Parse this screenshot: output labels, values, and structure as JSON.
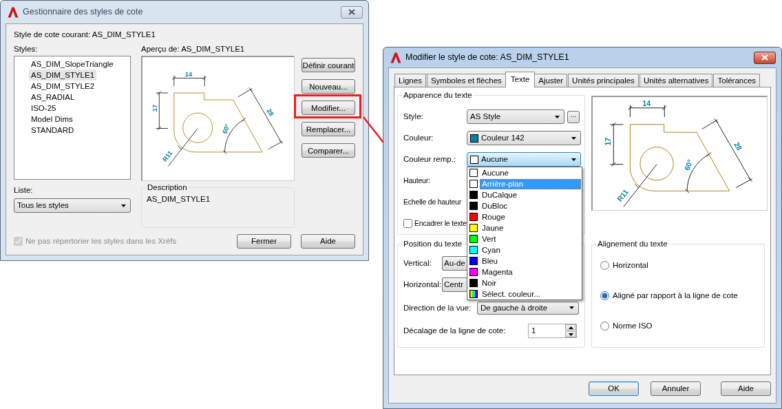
{
  "style_manager": {
    "title": "Gestionnaire des styles de cote",
    "active": false,
    "current_style": "Style de cote courant: AS_DIM_STYLE1",
    "styles_label": "Styles:",
    "styles": [
      {
        "label": "AS_DIM_SlopeTriangle",
        "selected": false
      },
      {
        "label": "AS_DIM_STYLE1",
        "selected": true
      },
      {
        "label": "AS_DIM_STYLE2",
        "selected": false
      },
      {
        "label": "AS_RADIAL",
        "selected": false
      },
      {
        "label": "ISO-25",
        "selected": false
      },
      {
        "label": "Model Dims",
        "selected": false
      },
      {
        "label": "STANDARD",
        "selected": false
      }
    ],
    "list_label": "Liste:",
    "list_filter": "Tous les styles",
    "preview_label": "Aperçu de: AS_DIM_STYLE1",
    "preview_dimensions": [
      "14",
      "17",
      "28",
      "60°",
      "R11"
    ],
    "description_label": "Description",
    "description": "AS_DIM_STYLE1",
    "buttons": [
      {
        "label": "Définir courant",
        "highlighted": false
      },
      {
        "label": "Nouveau...",
        "highlighted": false
      },
      {
        "label": "Modifier...",
        "highlighted": true
      },
      {
        "label": "Remplacer...",
        "highlighted": false
      },
      {
        "label": "Comparer...",
        "highlighted": false
      }
    ],
    "xref_option": {
      "label": "Ne pas répertorier les styles dans les Xréfs",
      "checked": true,
      "disabled": true
    },
    "footer_buttons": [
      {
        "label": "Fermer",
        "default": false
      },
      {
        "label": "Aide",
        "default": false
      }
    ]
  },
  "modify_dialog": {
    "title": "Modifier le style de cote: AS_DIM_STYLE1",
    "active": true,
    "tabs": [
      {
        "label": "Lignes",
        "selected": false
      },
      {
        "label": "Symboles et flèches",
        "selected": false
      },
      {
        "label": "Texte",
        "selected": true
      },
      {
        "label": "Ajuster",
        "selected": false
      },
      {
        "label": "Unités principales",
        "selected": false
      },
      {
        "label": "Unités alternatives",
        "selected": false
      },
      {
        "label": "Tolérances",
        "selected": false
      }
    ],
    "appearance": {
      "title": "Apparence du texte",
      "fields": [
        {
          "kind": "combo",
          "label": "Style:",
          "value": "AS Style",
          "button": "..."
        },
        {
          "kind": "color-combo",
          "label": "Couleur:",
          "value": "Couleur 142",
          "color": "#0b7ea3",
          "expanded": false
        },
        {
          "kind": "color-combo",
          "label": "Couleur remp.:",
          "value": "Aucune",
          "color": "#ffffff",
          "expanded": true
        },
        {
          "kind": "label",
          "label": "Hauteur:"
        },
        {
          "kind": "label",
          "label": "Echelle de hauteur"
        },
        {
          "kind": "checkbox",
          "label": "Encadrer le texte",
          "checked": false
        }
      ]
    },
    "color_list": [
      {
        "kind": "swatch",
        "label": "Aucune",
        "color": "#ffffff",
        "selected": false
      },
      {
        "kind": "swatch",
        "label": "Arrière-plan",
        "color": "#ffffff",
        "selected": true
      },
      {
        "kind": "swatch",
        "label": "DuCalque",
        "color": "#000000",
        "selected": false
      },
      {
        "kind": "swatch",
        "label": "DuBloc",
        "color": "#000000",
        "selected": false
      },
      {
        "kind": "swatch",
        "label": "Rouge",
        "color": "#ff0000",
        "selected": false
      },
      {
        "kind": "swatch",
        "label": "Jaune",
        "color": "#ffff00",
        "selected": false
      },
      {
        "kind": "swatch",
        "label": "Vert",
        "color": "#00ff00",
        "selected": false
      },
      {
        "kind": "swatch",
        "label": "Cyan",
        "color": "#00ffff",
        "selected": false
      },
      {
        "kind": "swatch",
        "label": "Bleu",
        "color": "#0000ff",
        "selected": false
      },
      {
        "kind": "swatch",
        "label": "Magenta",
        "color": "#ff00ff",
        "selected": false
      },
      {
        "kind": "swatch",
        "label": "Noir",
        "color": "#000000",
        "selected": false
      },
      {
        "kind": "picker",
        "label": "Sélect. couleur...",
        "selected": false
      }
    ],
    "preview_dimensions": [
      "14",
      "17",
      "28",
      "60°",
      "R11"
    ],
    "position": {
      "title": "Position du texte",
      "fields": [
        {
          "kind": "covered-combo",
          "label": "Vertical:",
          "value": "Au-de"
        },
        {
          "kind": "covered-combo",
          "label": "Horizontal:",
          "value": "Centr"
        },
        {
          "kind": "combo",
          "label": "Direction de la vue:",
          "value": "De gauche à droite"
        },
        {
          "kind": "spinner",
          "label": "Décalage de la ligne de cote:",
          "value": "1"
        }
      ]
    },
    "alignment": {
      "title": "Alignement du texte",
      "options": [
        {
          "label": "Horizontal",
          "selected": false
        },
        {
          "label": "Aligné par rapport à la ligne de cote",
          "selected": true
        },
        {
          "label": "Norme ISO",
          "selected": false
        }
      ]
    },
    "buttons": [
      {
        "label": "OK",
        "default": true
      },
      {
        "label": "Annuler",
        "default": false
      },
      {
        "label": "Aide",
        "default": false
      }
    ]
  }
}
